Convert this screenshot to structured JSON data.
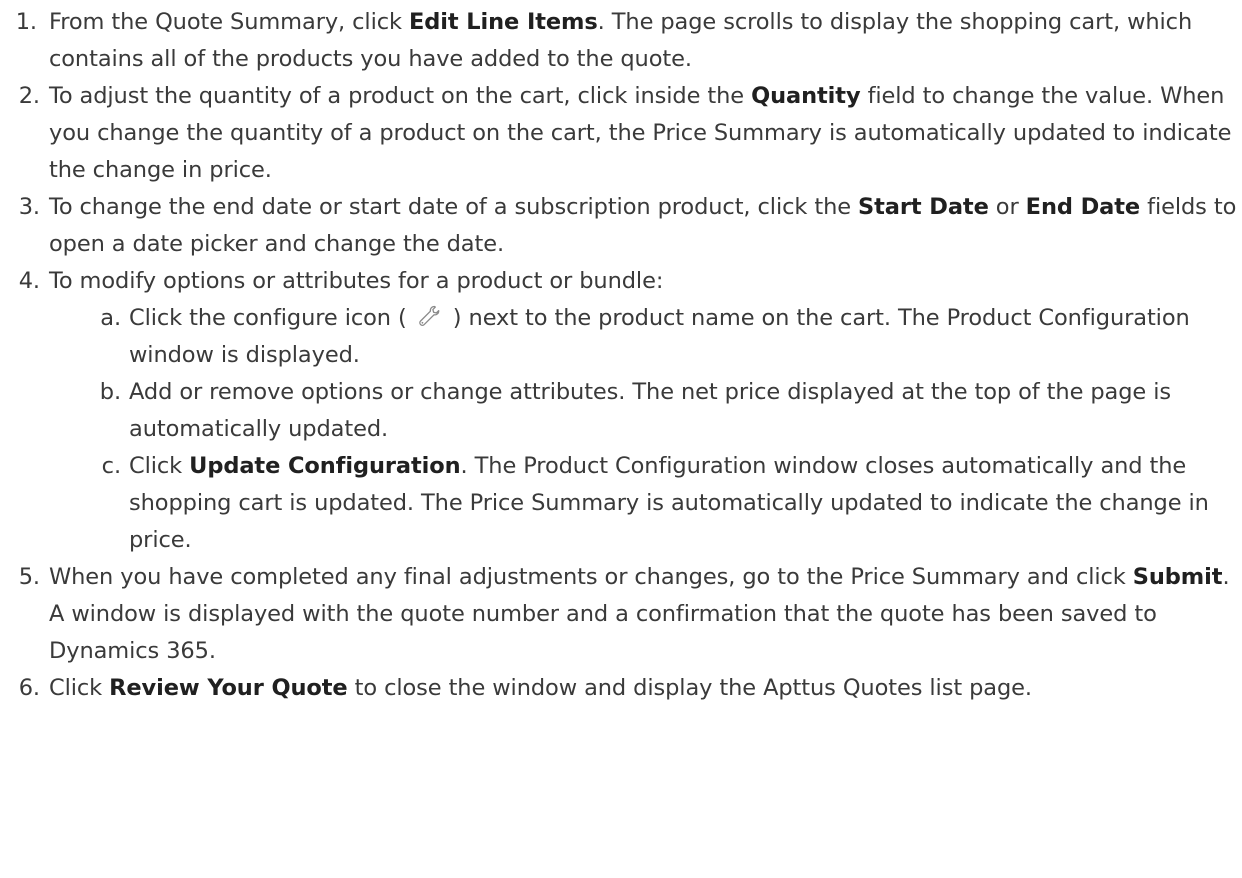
{
  "steps": [
    {
      "num": "1.",
      "parts": {
        "t1": "From the Quote Summary, click ",
        "b1": "Edit Line Items",
        "t2": ". The page scrolls to display the shopping cart, which contains all of the products you have added to the quote."
      }
    },
    {
      "num": "2.",
      "parts": {
        "t1": "To adjust the quantity of a product on the cart, click inside the ",
        "b1": "Quantity",
        "t2": " field to change the value. When you change the quantity of a product on the cart, the Price Summary is automatically updated to indicate the change in price."
      }
    },
    {
      "num": "3.",
      "parts": {
        "t1": "To change the end date or start date of a subscription product, click the ",
        "b1": "Start Date",
        "t2": " or ",
        "b2": "End Date",
        "t3": " fields to open a date picker and change the date."
      }
    },
    {
      "num": "4.",
      "parts": {
        "t1": "To modify options or attributes for a product or bundle:"
      },
      "substeps": [
        {
          "num": "a.",
          "t1": "Click the configure icon ( ",
          "icon": "wrench-icon",
          "t2": " ) next to the product name on the cart. The Product Configuration window is displayed."
        },
        {
          "num": "b.",
          "t1": "Add or remove options or change attributes. The net price displayed at the top of the page is automatically updated."
        },
        {
          "num": "c.",
          "t1": "Click ",
          "b1": "Update Configuration",
          "t2": ". The Product Configuration window closes automatically and the shopping cart is updated. The Price Summary is automatically updated to indicate the change in price."
        }
      ]
    },
    {
      "num": "5.",
      "parts": {
        "t1": "When you have completed any final adjustments or changes, go to the Price Summary and click ",
        "b1": "Submit",
        "t2": ". A window is displayed with the quote number and a confirmation that the quote has been saved to Dynamics 365."
      }
    },
    {
      "num": "6.",
      "parts": {
        "t1": "Click ",
        "b1": "Review Your Quote",
        "t2": " to close the window and display the Apttus Quotes list page."
      }
    }
  ]
}
